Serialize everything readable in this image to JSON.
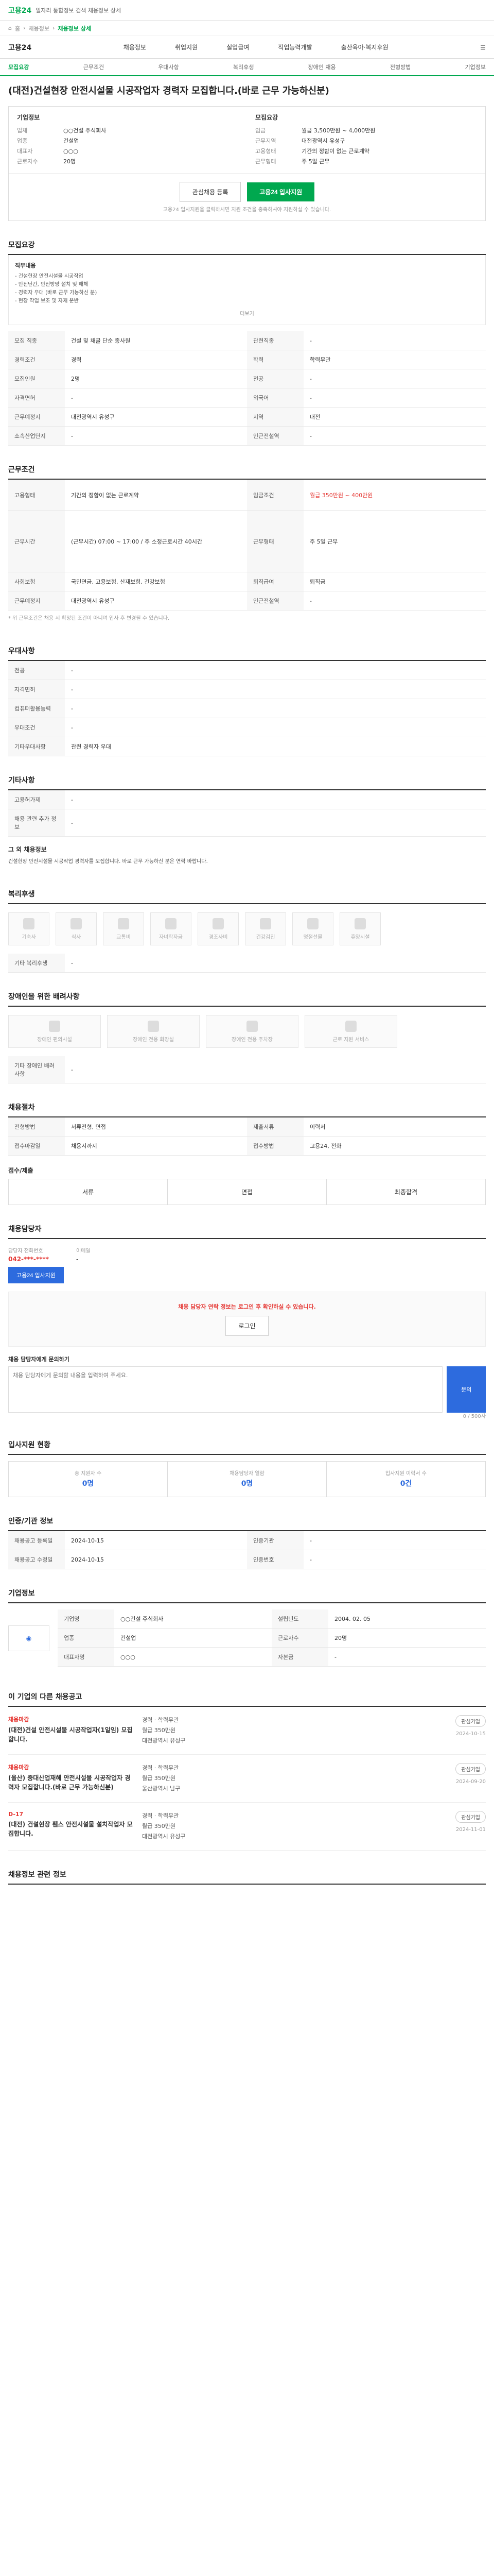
{
  "topbar": {
    "home": "고용24",
    "subtitle": "일자리 통합정보 검색 채용정보 상세"
  },
  "breadcrumb": [
    "홈",
    "채용정보",
    "채용정보 상세"
  ],
  "navbar": {
    "brand": "고용24",
    "menu": [
      "채용정보",
      "취업지원",
      "실업급여",
      "직업능력개발",
      "출산육아·복지후원"
    ]
  },
  "tabs": [
    "모집요강",
    "근무조건",
    "우대사항",
    "복리후생",
    "장애인 채용",
    "전형방법",
    "기업정보"
  ],
  "job": {
    "title": "(대전)건설현장 안전시설물 시공작업자 경력자 모집합니다.(바로 근무 가능하신분)",
    "company_label": "기업정보",
    "company_rows": [
      {
        "k": "업체",
        "v": "○○건설 주식회사"
      },
      {
        "k": "업종",
        "v": "건설업"
      },
      {
        "k": "대표자",
        "v": "○○○"
      },
      {
        "k": "근로자수",
        "v": "20명"
      }
    ],
    "right_label": "모집요강",
    "right_rows": [
      {
        "k": "임금",
        "v": "월급 3,500만원 ~ 4,000만원"
      },
      {
        "k": "근무지역",
        "v": "대전광역시 유성구"
      },
      {
        "k": "고용형태",
        "v": "기간의 정함이 없는 근로계약"
      },
      {
        "k": "근무형태",
        "v": "주 5일 근무"
      }
    ],
    "apply_labels": {
      "scrap": "관심채용 등록",
      "apply": "고용24 입사지원"
    },
    "apply_note": "고용24 입사지원을 클릭하시면 지원 조건을 충족하셔야 지원하실 수 있습니다."
  },
  "recruit": {
    "head": "모집요강",
    "desc_title": "직무내용",
    "desc_lines": [
      "- 건설현장 안전시설물 시공작업",
      "- 안전난간, 안전방망 설치 및 해체",
      "- 경력자 우대 (바로 근무 가능하신 분)",
      "- 현장 작업 보조 및 자재 운반"
    ],
    "more_label": "더보기",
    "rows": [
      {
        "k": "모집 직종",
        "v": "건설 및 채굴 단순 종사원",
        "k2": "관련직종",
        "v2": "-"
      },
      {
        "k": "경력조건",
        "v": "경력",
        "k2": "학력",
        "v2": "학력무관"
      },
      {
        "k": "모집인원",
        "v": "2명",
        "k2": "전공",
        "v2": "-"
      },
      {
        "k": "자격면허",
        "v": "-",
        "k2": "외국어",
        "v2": "-"
      },
      {
        "k": "근무예정지",
        "v": "대전광역시 유성구",
        "k2": "지역",
        "v2": "대전"
      },
      {
        "k": "소속산업단지",
        "v": "-",
        "k2": "인근전철역",
        "v2": "-"
      }
    ]
  },
  "conditions": {
    "head": "근무조건",
    "rows": [
      {
        "k": "고용형태",
        "v": "기간의 정함이 없는 근로계약",
        "k2": "임금조건",
        "v2": "월급 350만원 ~ 400만원"
      },
      {
        "k": "근무시간",
        "v": "(근무시간) 07:00 ~ 17:00 / 주 소정근로시간 40시간",
        "k2": "근무형태",
        "v2": "주 5일 근무"
      },
      {
        "k": "사회보험",
        "v": "국민연금, 고용보험, 산재보험, 건강보험",
        "k2": "퇴직급여",
        "v2": "퇴직금"
      },
      {
        "k": "근무예정지",
        "v": "대전광역시 유성구",
        "k2": "인근전철역",
        "v2": "-"
      }
    ],
    "note": "* 위 근무조건은 채용 시 확정된 조건이 아니며 입사 후 변경될 수 있습니다."
  },
  "preferred": {
    "head": "우대사항",
    "rows": [
      {
        "k": "전공",
        "v": "-"
      },
      {
        "k": "자격면허",
        "v": "-"
      },
      {
        "k": "컴퓨터활용능력",
        "v": "-"
      },
      {
        "k": "우대조건",
        "v": "-"
      },
      {
        "k": "기타우대사항",
        "v": "관련 경력자 우대"
      }
    ]
  },
  "etc": {
    "head": "기타사항",
    "rows": [
      {
        "k": "고용허가제",
        "v": "-"
      },
      {
        "k": "채용 관련 추가 정보",
        "v": "-"
      }
    ],
    "detail_title": "그 외 채용정보",
    "detail_text": "건설현장 안전시설물 시공작업 경력자를 모집합니다. 바로 근무 가능하신 분은 연락 바랍니다."
  },
  "welfare": {
    "head": "복리후생",
    "items": [
      "기숙사",
      "식사",
      "교통비",
      "자녀학자금",
      "경조사비",
      "건강검진",
      "명절선물",
      "휴양시설"
    ],
    "etc_label": "기타 복리후생",
    "etc_value": "-"
  },
  "disability": {
    "head": "장애인을 위한 배려사항",
    "items": [
      "장애인 편의시설",
      "장애인 전용 화장실",
      "장애인 전용 주차장",
      "근로 지원 서비스"
    ],
    "etc_label": "기타 장애인 배려사항",
    "etc_value": "-"
  },
  "process": {
    "head": "채용절차",
    "rows": [
      {
        "k": "전형방법",
        "v": "서류전형, 면접",
        "k2": "제출서류",
        "v2": "이력서"
      },
      {
        "k": "접수마감일",
        "v": "채용시까지",
        "k2": "접수방법",
        "v2": "고용24, 전화"
      }
    ],
    "apply_head": "접수/제출",
    "steps": [
      "서류",
      "면접",
      "최종합격"
    ]
  },
  "contact": {
    "head": "채용담당자",
    "labels": {
      "phone": "담당자 전화번호",
      "email": "이메일"
    },
    "phone": "042-***-****",
    "email": "-",
    "apply_button": "고용24 입사지원",
    "notice": "채용 담당자 연락 정보는 로그인 후 확인하실 수 있습니다.",
    "login_button": "로그인",
    "inquiry_label": "채용 담당자에게 문의하기",
    "inquiry_placeholder": "채용 담당자에게 문의할 내용을 입력하여 주세요.",
    "inquiry_submit": "문의",
    "char_count": "0 / 500자"
  },
  "similar": {
    "head": "입사지원 현황",
    "stats": [
      {
        "label": "총 지원자 수",
        "value": "0명"
      },
      {
        "label": "채용담당자 열람",
        "value": "0명"
      },
      {
        "label": "입사지원 이력서 수",
        "value": "0건"
      }
    ]
  },
  "info": {
    "head": "인증/기관 정보",
    "rows": [
      {
        "k": "채용공고 등록일",
        "v": "2024-10-15",
        "k2": "인증기관",
        "v2": "-"
      },
      {
        "k": "채용공고 수정일",
        "v": "2024-10-15",
        "k2": "인증번호",
        "v2": "-"
      }
    ]
  },
  "company": {
    "head": "기업정보",
    "rows": [
      {
        "k": "기업명",
        "v": "○○건설 주식회사",
        "k2": "설립년도",
        "v2": "2004. 02. 05"
      },
      {
        "k": "업종",
        "v": "건설업",
        "k2": "근로자수",
        "v2": "20명"
      },
      {
        "k": "대표자명",
        "v": "○○○",
        "k2": "자본금",
        "v2": "-"
      }
    ]
  },
  "others": {
    "head": "이 기업의 다른 채용공고",
    "items": [
      {
        "badge": "채용마감",
        "title": "(대전)건설 안전시설물 시공작업자(1일임) 모집합니다.",
        "meta": [
          "경력 · 학력무관",
          "월급 350만원",
          "대전광역시 유성구"
        ],
        "date": "2024-10-15"
      },
      {
        "badge": "채용마감",
        "title": "(울산) 중대산업재해 안전시설물 시공작업자 경력자 모집합니다.(바로 근무 가능하신분)",
        "meta": [
          "경력 · 학력무관",
          "월급 350만원",
          "울산광역시 남구"
        ],
        "date": "2024-09-20"
      },
      {
        "badge": "D-17",
        "title": "(대전) 건설현장 휀스 안전시설물 설치작업자 모집합니다.",
        "meta": [
          "경력 · 학력무관",
          "월급 350만원",
          "대전광역시 유성구"
        ],
        "date": "2024-11-01"
      }
    ],
    "chip": "관심기업"
  },
  "footer": {
    "head": "채용정보 관련 정보"
  }
}
